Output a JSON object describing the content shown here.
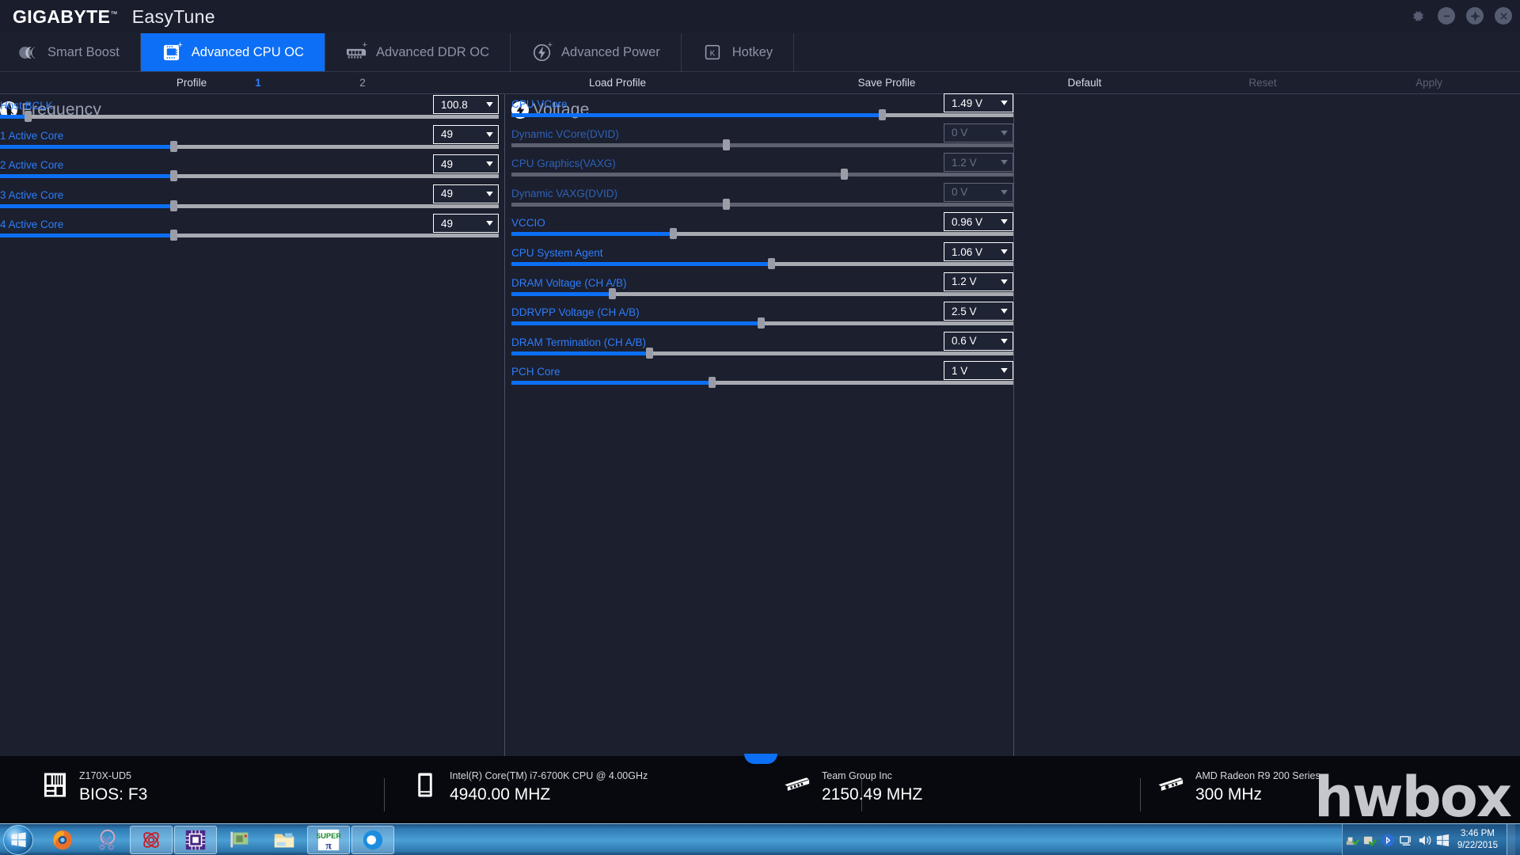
{
  "window": {
    "brand": "GIGABYTE",
    "brand_tm": "™",
    "app_name": "EasyTune",
    "controls": [
      {
        "name": "settings",
        "icon": "gear-icon"
      },
      {
        "name": "minimize",
        "icon": "minimize-icon"
      },
      {
        "name": "info",
        "icon": "info-icon"
      },
      {
        "name": "close",
        "icon": "close-icon"
      }
    ]
  },
  "tabs": [
    {
      "label": "Smart Boost",
      "icon": "smart-boost-icon",
      "active": false,
      "plus": false
    },
    {
      "label": "Advanced CPU OC",
      "icon": "cpu-chip-icon",
      "active": true,
      "plus": true
    },
    {
      "label": "Advanced DDR OC",
      "icon": "memory-module-icon",
      "active": false,
      "plus": true
    },
    {
      "label": "Advanced Power",
      "icon": "lightning-bolt-icon",
      "active": false,
      "plus": true
    },
    {
      "label": "Hotkey",
      "icon": "keyboard-key-icon",
      "active": false,
      "plus": false
    }
  ],
  "toolbar": {
    "profile_label": "Profile",
    "profile_1": "1",
    "profile_2": "2",
    "load_profile": "Load Profile",
    "save_profile": "Save Profile",
    "default": "Default",
    "reset": "Reset",
    "apply": "Apply"
  },
  "frequency": {
    "title": "Frequency",
    "icon": "speedometer-icon",
    "rows": [
      {
        "label": "Host BCLK",
        "value": "100.8",
        "fill_pct": 5.5,
        "disabled": false
      },
      {
        "label": "1 Active Core",
        "value": "49",
        "fill_pct": 34.8,
        "disabled": false
      },
      {
        "label": "2 Active Core",
        "value": "49",
        "fill_pct": 34.8,
        "disabled": false
      },
      {
        "label": "3 Active Core",
        "value": "49",
        "fill_pct": 34.8,
        "disabled": false
      },
      {
        "label": "4 Active Core",
        "value": "49",
        "fill_pct": 34.8,
        "disabled": false
      }
    ]
  },
  "voltage": {
    "title": "Voltage",
    "icon": "lightning-bolt-icon",
    "rows": [
      {
        "label": "CPU VCore",
        "value": "1.49 V",
        "fill_pct": 73.8,
        "disabled": false
      },
      {
        "label": "Dynamic VCore(DVID)",
        "value": "0 V",
        "fill_pct": 42.8,
        "disabled": true
      },
      {
        "label": "CPU Graphics(VAXG)",
        "value": "1.2 V",
        "fill_pct": 66.3,
        "disabled": true
      },
      {
        "label": "Dynamic VAXG(DVID)",
        "value": "0 V",
        "fill_pct": 42.8,
        "disabled": true
      },
      {
        "label": "VCCIO",
        "value": "0.96 V",
        "fill_pct": 32.2,
        "disabled": false
      },
      {
        "label": "CPU System Agent",
        "value": "1.06 V",
        "fill_pct": 51.8,
        "disabled": false
      },
      {
        "label": "DRAM Voltage (CH A/B)",
        "value": "1.2 V",
        "fill_pct": 20.1,
        "disabled": false
      },
      {
        "label": "DDRVPP Voltage (CH A/B)",
        "value": "2.5 V",
        "fill_pct": 49.7,
        "disabled": false
      },
      {
        "label": "DRAM Termination (CH A/B)",
        "value": "0.6 V",
        "fill_pct": 27.5,
        "disabled": false
      },
      {
        "label": "PCH Core",
        "value": "1 V",
        "fill_pct": 39.9,
        "disabled": false
      }
    ]
  },
  "status": [
    {
      "icon": "motherboard-icon",
      "sub": "Z170X-UD5",
      "main": "BIOS: F3"
    },
    {
      "icon": "cpu-icon",
      "sub": "Intel(R) Core(TM) i7-6700K CPU @ 4.00GHz",
      "main": "4940.00 MHZ"
    },
    {
      "icon": "memory-icon",
      "sub": "Team Group Inc",
      "main": "2150.49 MHZ"
    },
    {
      "icon": "gpu-icon",
      "sub": "AMD Radeon R9 200 Series",
      "main": "300 MHz"
    }
  ],
  "watermark": "hwbox",
  "taskbar": {
    "start": "start-orb-icon",
    "apps": [
      {
        "name": "firefox-icon",
        "open": false
      },
      {
        "name": "snipping-tool-icon",
        "open": false
      },
      {
        "name": "app-red-icon",
        "open": true
      },
      {
        "name": "cpu-z-icon",
        "open": true
      },
      {
        "name": "gpu-z-icon",
        "open": false
      },
      {
        "name": "explorer-icon",
        "open": false
      },
      {
        "name": "superpi-icon",
        "open": true
      },
      {
        "name": "easytune-icon",
        "open": true
      }
    ],
    "tray": [
      "safely-remove-icon",
      "antivirus-icon",
      "bluetooth-icon",
      "network-icon",
      "volume-icon",
      "action-center-icon"
    ],
    "clock_time": "3:46 PM",
    "clock_date": "9/22/2015"
  },
  "colors": {
    "accent": "#0c6ff5",
    "label_blue": "#2f7dfb",
    "panel_bg": "#1b1f2e",
    "titlebar_bg": "#191d2c",
    "status_bg": "#07090e"
  }
}
